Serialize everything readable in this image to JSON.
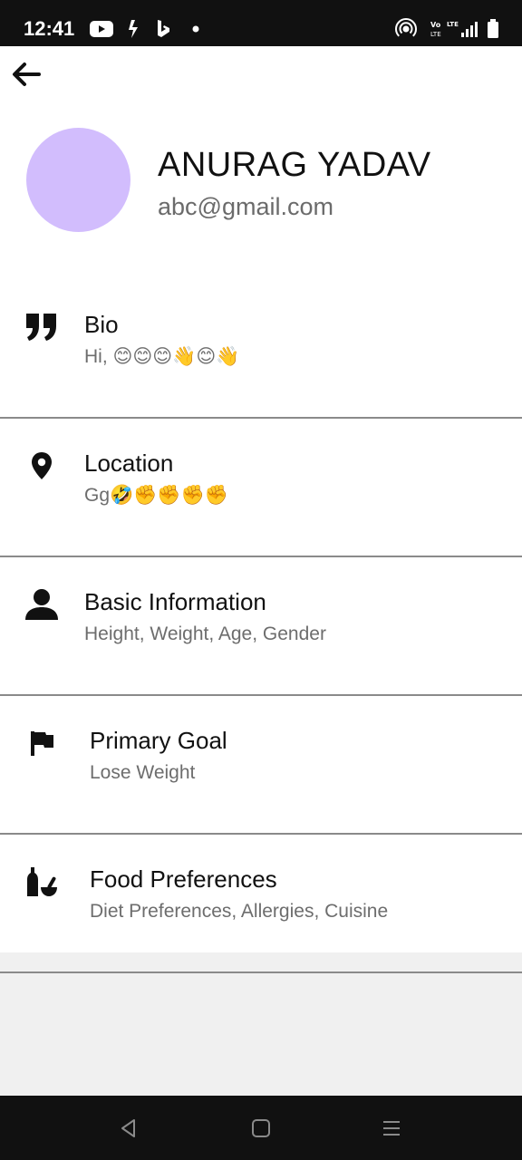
{
  "status_bar": {
    "time": "12:41",
    "left_icons": [
      "youtube-icon",
      "app-k-icon",
      "bing-icon",
      "dot-icon"
    ],
    "right_icons": [
      "hotspot-icon",
      "volte-lte-signal-icon",
      "battery-icon"
    ],
    "volte_label": "Vo LTE",
    "lte_label": "LTE"
  },
  "header": {
    "back_icon": "arrow-left-icon"
  },
  "profile": {
    "name": "ANURAG YADAV",
    "email": "abc@gmail.com",
    "avatar_color": "#d2bdfd"
  },
  "rows": [
    {
      "icon": "quote-icon",
      "title": "Bio",
      "subtitle": "Hi, 😊😊😊👋😊👋"
    },
    {
      "icon": "location-pin-icon",
      "title": "Location",
      "subtitle": "Gg🤣✊✊✊✊"
    },
    {
      "icon": "person-icon",
      "title": "Basic Information",
      "subtitle": "Height, Weight, Age, Gender"
    },
    {
      "icon": "flag-icon",
      "title": "Primary Goal",
      "subtitle": "Lose Weight"
    },
    {
      "icon": "mortar-pestle-icon",
      "title": "Food Preferences",
      "subtitle": "Diet Preferences, Allergies, Cuisine"
    }
  ],
  "nav_bar": {
    "icons": [
      "nav-back-icon",
      "nav-home-icon",
      "nav-menu-icon"
    ]
  },
  "colors": {
    "status_bar_bg": "#111111",
    "content_bg": "#ffffff",
    "page_bg": "#f0f0f0",
    "divider": "#8a8a8a",
    "subtitle_text": "#6d6d6d"
  }
}
